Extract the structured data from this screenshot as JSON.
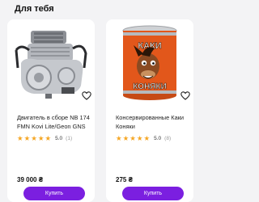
{
  "section": {
    "title": "Для тебя"
  },
  "products": [
    {
      "name": "Двигатель в сборе NB 174 FMN Kovi Lite/Geon GNS",
      "rating": "5.0",
      "reviews": "(1)",
      "price": "39 000 ₴",
      "buy_label": "Купить",
      "image": "engine-image",
      "favorite_icon": "heart-icon"
    },
    {
      "name": "Консервированные Каки Коняки",
      "rating": "5.0",
      "reviews": "(8)",
      "price": "275 ₴",
      "buy_label": "Купить",
      "image": "canned-goods-image",
      "favorite_icon": "heart-icon"
    }
  ],
  "can_label": {
    "line1": "КАКИ",
    "line2": "КОНЯКИ"
  },
  "colors": {
    "accent": "#7b1fe0",
    "star": "#f5a623",
    "can": "#e2571b"
  }
}
